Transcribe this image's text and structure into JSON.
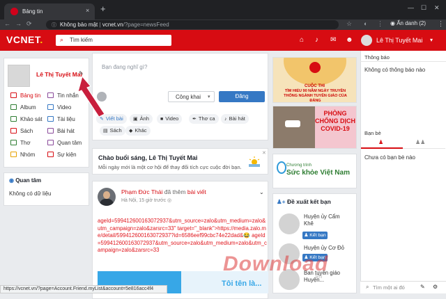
{
  "browser": {
    "tab_title": "Bảng tin",
    "tab_close": "×",
    "new_tab": "+",
    "window_controls": [
      "—",
      "☐",
      "✕"
    ],
    "security_label": "Không bảo mật",
    "url_host": "vcnet.vn",
    "url_path": "/?page=newsFeed",
    "profile_label": "Ẩn danh (2)",
    "status_url": "https://vcnet.vn/?page=Account.Friend.myList&account=5e816acc4f4"
  },
  "header": {
    "logo_main": "VCNET",
    "logo_dot": ".",
    "search_placeholder": "Tìm kiếm",
    "user_name": "Lê Thị Tuyết Mai"
  },
  "profile": {
    "name": "Lê Thị Tuyết Mai",
    "menu": [
      {
        "label": "Bảng tin",
        "icon": "newsfeed-icon",
        "color": "#d70c12",
        "active": true
      },
      {
        "label": "Tin nhắn",
        "icon": "message-icon",
        "color": "#8a4a9a"
      },
      {
        "label": "Album",
        "icon": "album-icon",
        "color": "#2e7d32"
      },
      {
        "label": "Video",
        "icon": "video-icon",
        "color": "#3578c4"
      },
      {
        "label": "Khảo sát",
        "icon": "survey-icon",
        "color": "#2e7d32"
      },
      {
        "label": "Tài liệu",
        "icon": "document-icon",
        "color": "#3578c4"
      },
      {
        "label": "Sách",
        "icon": "book-icon",
        "color": "#d70c12"
      },
      {
        "label": "Bài hát",
        "icon": "music-icon",
        "color": "#8a4a9a"
      },
      {
        "label": "Thơ",
        "icon": "poem-icon",
        "color": "#2e7d32"
      },
      {
        "label": "Quan tâm",
        "icon": "interest-icon",
        "color": "#8a4a9a"
      },
      {
        "label": "Nhóm",
        "icon": "group-icon",
        "color": "#e6a100"
      },
      {
        "label": "Sự kiện",
        "icon": "event-icon",
        "color": "#d70c12"
      }
    ]
  },
  "interests": {
    "title": "Quan tâm",
    "empty": "Không có dữ liệu"
  },
  "composer": {
    "placeholder": "Bạn đang nghĩ gì?",
    "visibility": "Công khai",
    "post_button": "Đăng",
    "types": [
      "Viết bài",
      "Ảnh",
      "Video",
      "Thơ ca",
      "Bài hát",
      "Sách",
      "Khác"
    ]
  },
  "greeting": {
    "title": "Chào buổi sáng, Lê Thị Tuyết Mai",
    "subtitle": "Mỗi ngày mới là một cơ hội để thay đổi tích cực cuộc đời bạn."
  },
  "post": {
    "author": "Phạm Đức Thái",
    "action": "đã thêm",
    "object": "bài viết",
    "location": "Hà Nội",
    "time": "15 giờ trước",
    "body": "ageId=599412600163072937&utm_source=zalo&utm_medium=zalo&utm_campaign=zalo&zarsrc=33\" target=\"_blank\">https://media.zalo.me/detail/599412600163072937?id=6586eef99cbc74e22dad&😂 ageId=599412600163072937&utm_source=zalo&utm_medium=zalo&utm_campaign=zalo&zarsrc=33",
    "image_text": "Tôi tên là..."
  },
  "banners": {
    "b1_top": "CUỘC THI",
    "b1_text": "TÌM HIỂU 90 NĂM NGÀY TRUYỀN THỐNG NGÀNH TUYÊN GIÁO CỦA ĐẢNG",
    "b2_text": "PHÒNG CHỐNG DỊCH COVID-19",
    "b3_small": "Chương trình",
    "b3_big": "Sức khỏe Việt Nam"
  },
  "suggestions": {
    "title": "Đề xuất kết bạn",
    "button": "Kết bạn",
    "items": [
      {
        "name_l1": "Huyện ủy Cẩm",
        "name_l2": "Khê"
      },
      {
        "name_l1": "Huyện ủy Cơ Đỏ",
        "name_l2": ""
      },
      {
        "name_l1": "Ban tuyên giáo",
        "name_l2": "Huyện..."
      }
    ]
  },
  "sidebar": {
    "notifications_title": "Thông báo",
    "notifications_empty": "Không có thông báo nào",
    "friends_title": "Bạn bè",
    "friends_empty": "Chưa có bạn bè nào",
    "search_placeholder": "Tìm một ai đó"
  },
  "watermark": {
    "main": "Download",
    "sub": ".vn"
  },
  "colors": {
    "brand": "#d70c12",
    "primary": "#3578c4"
  }
}
